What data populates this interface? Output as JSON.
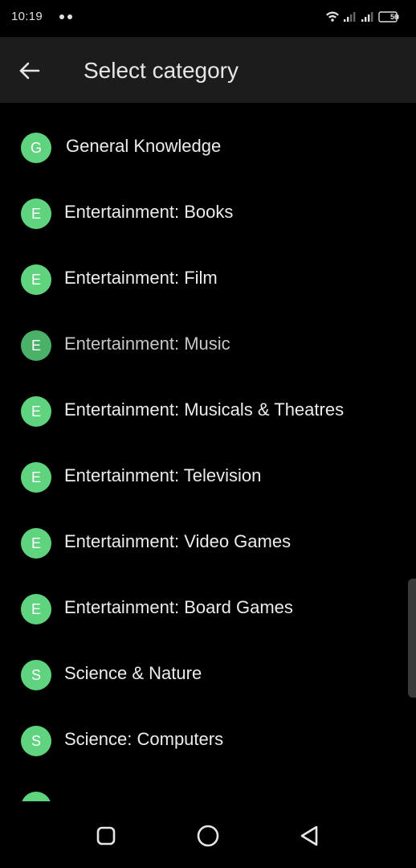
{
  "status_bar": {
    "time": "10:19",
    "battery": "56"
  },
  "app_bar": {
    "title": "Select category",
    "back_icon": "arrow-left-icon"
  },
  "colors": {
    "avatar": "#5fd37e",
    "app_bar_bg": "#1c1c1c",
    "background": "#000000"
  },
  "categories": [
    {
      "initial": "G",
      "label": "General Knowledge"
    },
    {
      "initial": "E",
      "label": "Entertainment: Books"
    },
    {
      "initial": "E",
      "label": "Entertainment: Film"
    },
    {
      "initial": "E",
      "label": "Entertainment: Music"
    },
    {
      "initial": "E",
      "label": "Entertainment: Musicals & Theatres"
    },
    {
      "initial": "E",
      "label": "Entertainment: Television"
    },
    {
      "initial": "E",
      "label": "Entertainment: Video Games"
    },
    {
      "initial": "E",
      "label": "Entertainment: Board Games"
    },
    {
      "initial": "S",
      "label": "Science & Nature"
    },
    {
      "initial": "S",
      "label": "Science: Computers"
    }
  ],
  "nav_bar": {
    "items": [
      "recents-square-icon",
      "home-circle-icon",
      "back-triangle-icon"
    ]
  }
}
